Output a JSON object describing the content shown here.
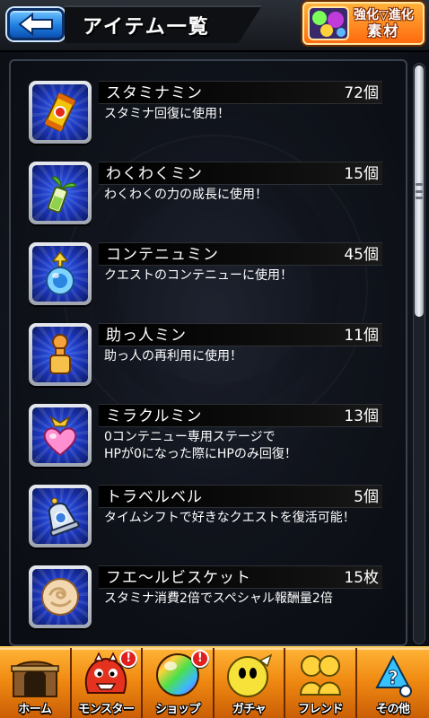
{
  "header": {
    "title": "アイテム一覧",
    "evolve_label_top": "強化▽進化",
    "evolve_label_bottom": "素材"
  },
  "items": [
    {
      "name": "スタミナミン",
      "count": "72個",
      "desc": "スタミナ回復に使用！",
      "icon": "stamina-can-icon"
    },
    {
      "name": "わくわくミン",
      "count": "15個",
      "desc": "わくわくの力の成長に使用！",
      "icon": "sprout-bottle-icon"
    },
    {
      "name": "コンテニュミン",
      "count": "45個",
      "desc": "クエストのコンテニューに使用！",
      "icon": "continue-potion-icon"
    },
    {
      "name": "助っ人ミン",
      "count": "11個",
      "desc": "助っ人の再利用に使用！",
      "icon": "helper-bottle-icon"
    },
    {
      "name": "ミラクルミン",
      "count": "13個",
      "desc": "0コンテニュー専用ステージで",
      "desc2": "HPが0になった際にHPのみ回復！",
      "icon": "miracle-heart-potion-icon"
    },
    {
      "name": "トラベルベル",
      "count": "5個",
      "desc": "タイムシフトで好きなクエストを復活可能！",
      "icon": "travel-bell-icon"
    },
    {
      "name": "フエ〜ルビスケット",
      "count": "15枚",
      "desc": "スタミナ消費2倍でスペシャル報酬量2倍",
      "icon": "biscuit-icon"
    }
  ],
  "nav": [
    {
      "label": "ホーム",
      "icon": "home-gate-icon",
      "badge": ""
    },
    {
      "label": "モンスター",
      "icon": "monster-icon",
      "badge": "!"
    },
    {
      "label": "ショップ",
      "icon": "rainbow-orb-icon",
      "badge": "!"
    },
    {
      "label": "ガチャ",
      "icon": "gacha-egg-icon",
      "badge": ""
    },
    {
      "label": "フレンド",
      "icon": "friends-icon",
      "badge": ""
    },
    {
      "label": "その他",
      "icon": "more-icon",
      "badge": ""
    }
  ],
  "colors": {
    "accent_orange": "#f08a12",
    "back_blue": "#1f7fe0",
    "icon_frame_blue": "#1b35b8"
  }
}
